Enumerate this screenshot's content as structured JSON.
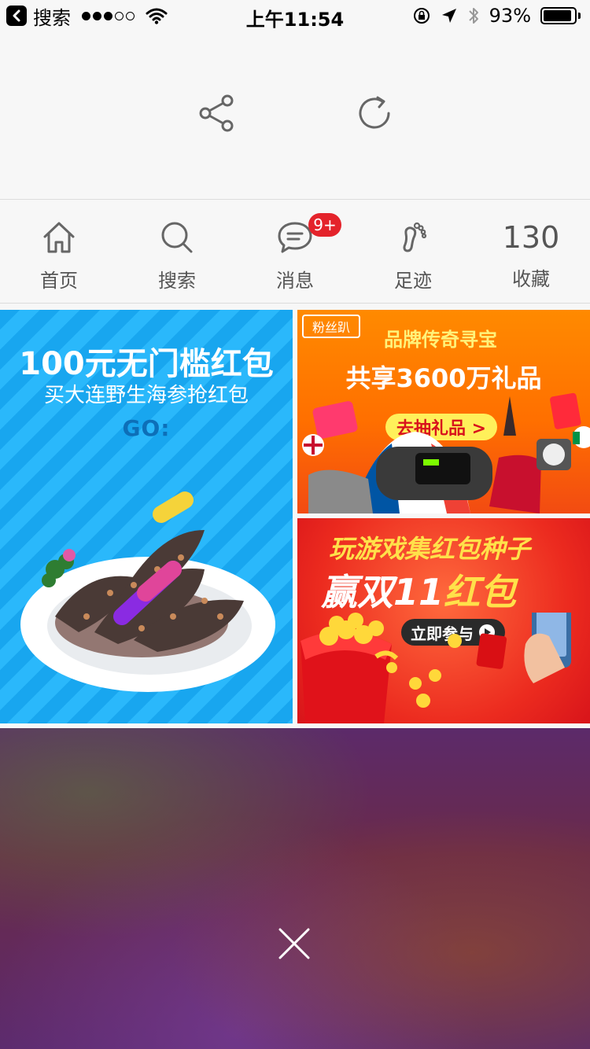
{
  "status_bar": {
    "back_app": "搜索",
    "time": "上午11:54",
    "battery": "93%",
    "battery_level": 0.93,
    "signal_strength_dots": 3
  },
  "top_actions": {
    "icons": [
      "share-icon",
      "refresh-icon"
    ]
  },
  "nav": {
    "items": [
      {
        "label": "首页",
        "icon": "home-icon"
      },
      {
        "label": "搜索",
        "icon": "search-icon"
      },
      {
        "label": "消息",
        "icon": "message-icon",
        "badge": "9+"
      },
      {
        "label": "足迹",
        "icon": "footprint-icon"
      },
      {
        "label": "收藏",
        "count": "130"
      }
    ]
  },
  "promos": {
    "left": {
      "title": "100元无门槛红包",
      "subtitle": "买大连野生海参抢红包",
      "logo": "GO:"
    },
    "top_right": {
      "brand": "粉丝趴",
      "tagline": "品牌传奇寻宝",
      "headline": "共享3600万礼品",
      "cta": "去抽礼品 >"
    },
    "bottom_right": {
      "line1": "玩游戏集红包种子",
      "line2_prefix": "赢双11",
      "line2_highlight": "红包",
      "cta": "立即参与"
    }
  },
  "overlay": {
    "close_icon": "close-icon"
  },
  "colors": {
    "badge": "#e4232b",
    "promo_left_bg": "#18a6ef",
    "promo_top_right_bg": "#ff7a00",
    "promo_bottom_right_bg": "#e52a1f"
  }
}
